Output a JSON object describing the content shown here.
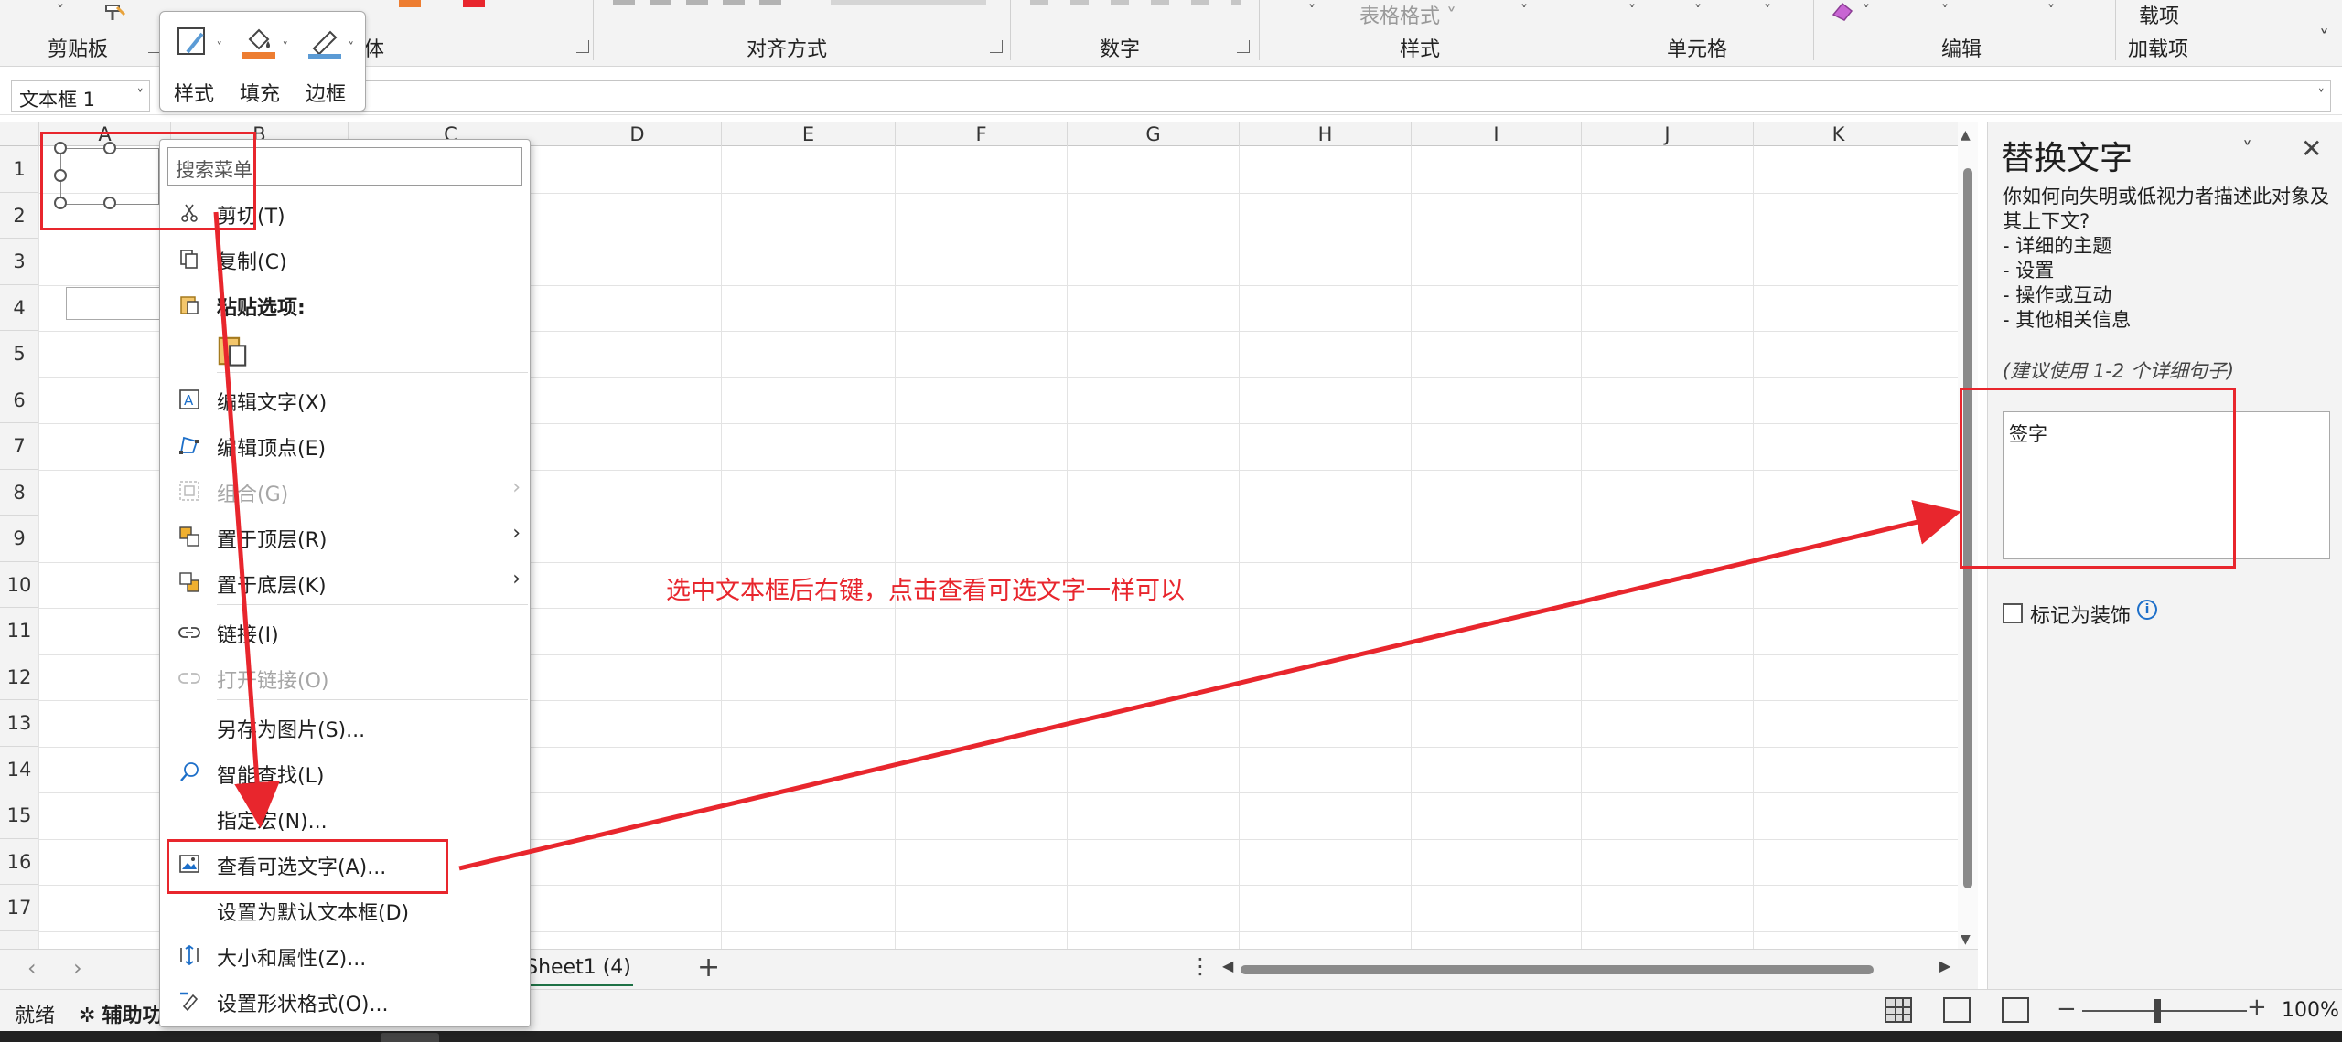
{
  "ribbon": {
    "groups": [
      {
        "label": "剪贴板"
      },
      {
        "label": "体"
      },
      {
        "label": "对齐方式"
      },
      {
        "label": "数字"
      },
      {
        "label": "样式"
      },
      {
        "label": "单元格"
      },
      {
        "label": "编辑"
      },
      {
        "label": "加载项"
      }
    ],
    "faded_top_labels": {
      "format_table": "表格格式 ˅",
      "addin_top": "载项"
    }
  },
  "mini_toolbar": {
    "items": [
      {
        "label": "样式",
        "icon": "shape-style-icon"
      },
      {
        "label": "填充",
        "icon": "fill-bucket-icon",
        "accent": "#ed7d31"
      },
      {
        "label": "边框",
        "icon": "outline-pen-icon",
        "accent": "#5b9bd5"
      }
    ]
  },
  "formula_bar": {
    "name_box": "文本框 1",
    "formula": ""
  },
  "grid": {
    "columns": [
      "A",
      "B",
      "C",
      "D",
      "E",
      "F",
      "G",
      "H",
      "I",
      "J",
      "K"
    ],
    "rows": [
      "1",
      "2",
      "3",
      "4",
      "5",
      "6",
      "7",
      "8",
      "9",
      "10",
      "11",
      "12",
      "13",
      "14",
      "15",
      "16",
      "17"
    ]
  },
  "annotation": {
    "text": "选中文本框后右键，点击查看可选文字一样可以",
    "color": "#e8262d"
  },
  "context_menu": {
    "search_placeholder": "搜索菜单",
    "items": [
      {
        "label": "剪切(T)",
        "icon": "scissors-icon"
      },
      {
        "label": "复制(C)",
        "icon": "copy-icon"
      },
      {
        "label": "粘贴选项:",
        "icon": "paste-icon",
        "bold": true
      },
      {
        "label": "",
        "icon": "paste-default-icon"
      },
      {
        "label": "编辑文字(X)",
        "icon": "edit-text-icon"
      },
      {
        "label": "编辑顶点(E)",
        "icon": "edit-points-icon"
      },
      {
        "label": "组合(G)",
        "icon": "group-icon",
        "disabled": true,
        "submenu": true
      },
      {
        "label": "置于顶层(R)",
        "icon": "bring-front-icon",
        "submenu": true
      },
      {
        "label": "置于底层(K)",
        "icon": "send-back-icon",
        "submenu": true
      },
      {
        "label": "链接(I)",
        "icon": "link-icon"
      },
      {
        "label": "打开链接(O)",
        "icon": "open-link-icon",
        "disabled": true
      },
      {
        "label": "另存为图片(S)...",
        "icon": ""
      },
      {
        "label": "智能查找(L)",
        "icon": "smart-lookup-icon"
      },
      {
        "label": "指定宏(N)...",
        "icon": ""
      },
      {
        "label": "查看可选文字(A)...",
        "icon": "alt-text-icon"
      },
      {
        "label": "设置为默认文本框(D)",
        "icon": ""
      },
      {
        "label": "大小和属性(Z)...",
        "icon": "size-properties-icon"
      },
      {
        "label": "设置形状格式(O)...",
        "icon": "format-shape-icon"
      }
    ]
  },
  "sheet_tabs": {
    "active": "Sheet1 (4)",
    "add": "+",
    "dots": "⋮"
  },
  "status_bar": {
    "ready": "就绪",
    "accessibility": "辅助功",
    "zoom": "100%"
  },
  "alt_text_pane": {
    "title": "替换文字",
    "description": [
      "你如何向失明或低视力者描述此对象及其上下文?",
      "- 详细的主题",
      "- 设置",
      "- 操作或互动",
      "- 其他相关信息"
    ],
    "hint": "(建议使用 1-2 个详细句子)",
    "textarea_value": "签字",
    "decorative_label": "标记为装饰",
    "info": "i"
  },
  "highlight_color": "#e8262d"
}
